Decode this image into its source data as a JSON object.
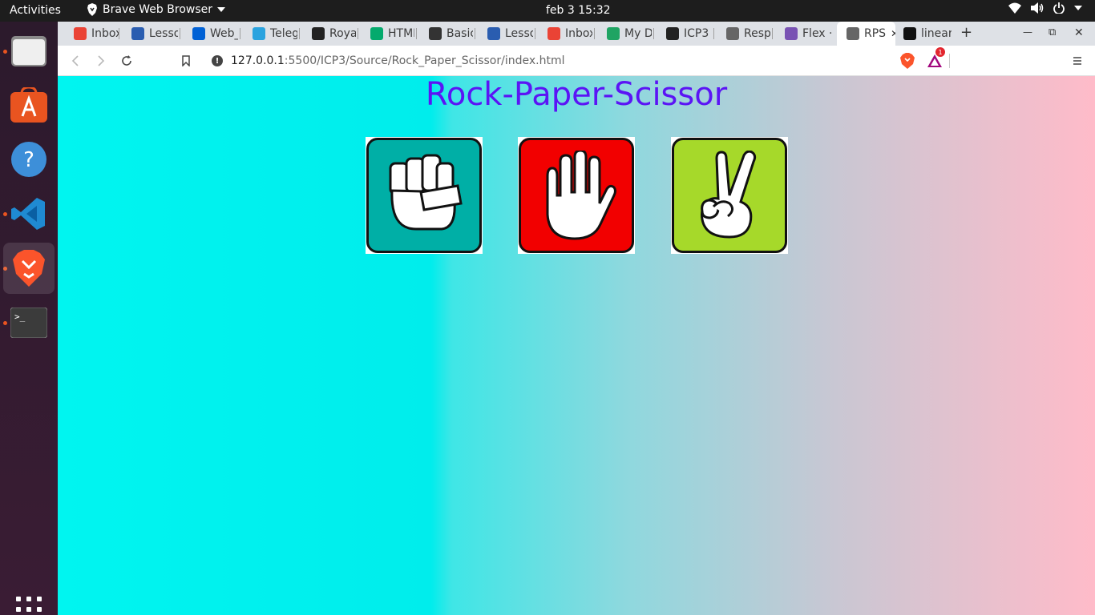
{
  "topbar": {
    "activities": "Activities",
    "app_name": "Brave Web Browser",
    "clock": "feb 3  15:32"
  },
  "dock": {
    "items": [
      "Files",
      "Ubuntu Software",
      "Help",
      "Visual Studio Code",
      "Brave",
      "Terminal"
    ]
  },
  "tabs": [
    {
      "label": "Inbox",
      "icon": "gmail-icon",
      "color": "#ea4335"
    },
    {
      "label": "Lesso",
      "icon": "umkc-icon",
      "color": "#2a5db0"
    },
    {
      "label": "Web_",
      "icon": "box-icon",
      "color": "#0061d5"
    },
    {
      "label": "Teleg",
      "icon": "telegram-icon",
      "color": "#2aa3df"
    },
    {
      "label": "Royal",
      "icon": "github-icon",
      "color": "#222222"
    },
    {
      "label": "HTML",
      "icon": "w3schools-icon",
      "color": "#04aa6d"
    },
    {
      "label": "Basic",
      "icon": "markdown-icon",
      "color": "#333333"
    },
    {
      "label": "Lesso",
      "icon": "umkc-icon",
      "color": "#2a5db0"
    },
    {
      "label": "Inbox",
      "icon": "gmail-icon",
      "color": "#ea4335"
    },
    {
      "label": "My Dr",
      "icon": "google-drive-icon",
      "color": "#1fa463"
    },
    {
      "label": "ICP3 ·",
      "icon": "github-icon",
      "color": "#222222"
    },
    {
      "label": "Respo",
      "icon": "globe-icon",
      "color": "#666666"
    },
    {
      "label": "Flex ·",
      "icon": "bootstrap-icon",
      "color": "#7952b3"
    },
    {
      "label": "RPS",
      "icon": "globe-icon",
      "color": "#666666",
      "active": true
    },
    {
      "label": "linear",
      "icon": "codepen-icon",
      "color": "#111111"
    }
  ],
  "toolbar": {
    "url_host": "127.0.0.1",
    "url_path": ":5500/ICP3/Source/Rock_Paper_Scissor/index.html",
    "info_glyph": "!",
    "rewards_badge": "1"
  },
  "page": {
    "title": "Rock-Paper-Scissor",
    "choices": [
      {
        "name": "rock",
        "color": "#00afa6"
      },
      {
        "name": "paper",
        "color": "#f20000"
      },
      {
        "name": "scissor",
        "color": "#a6d92a"
      }
    ]
  }
}
